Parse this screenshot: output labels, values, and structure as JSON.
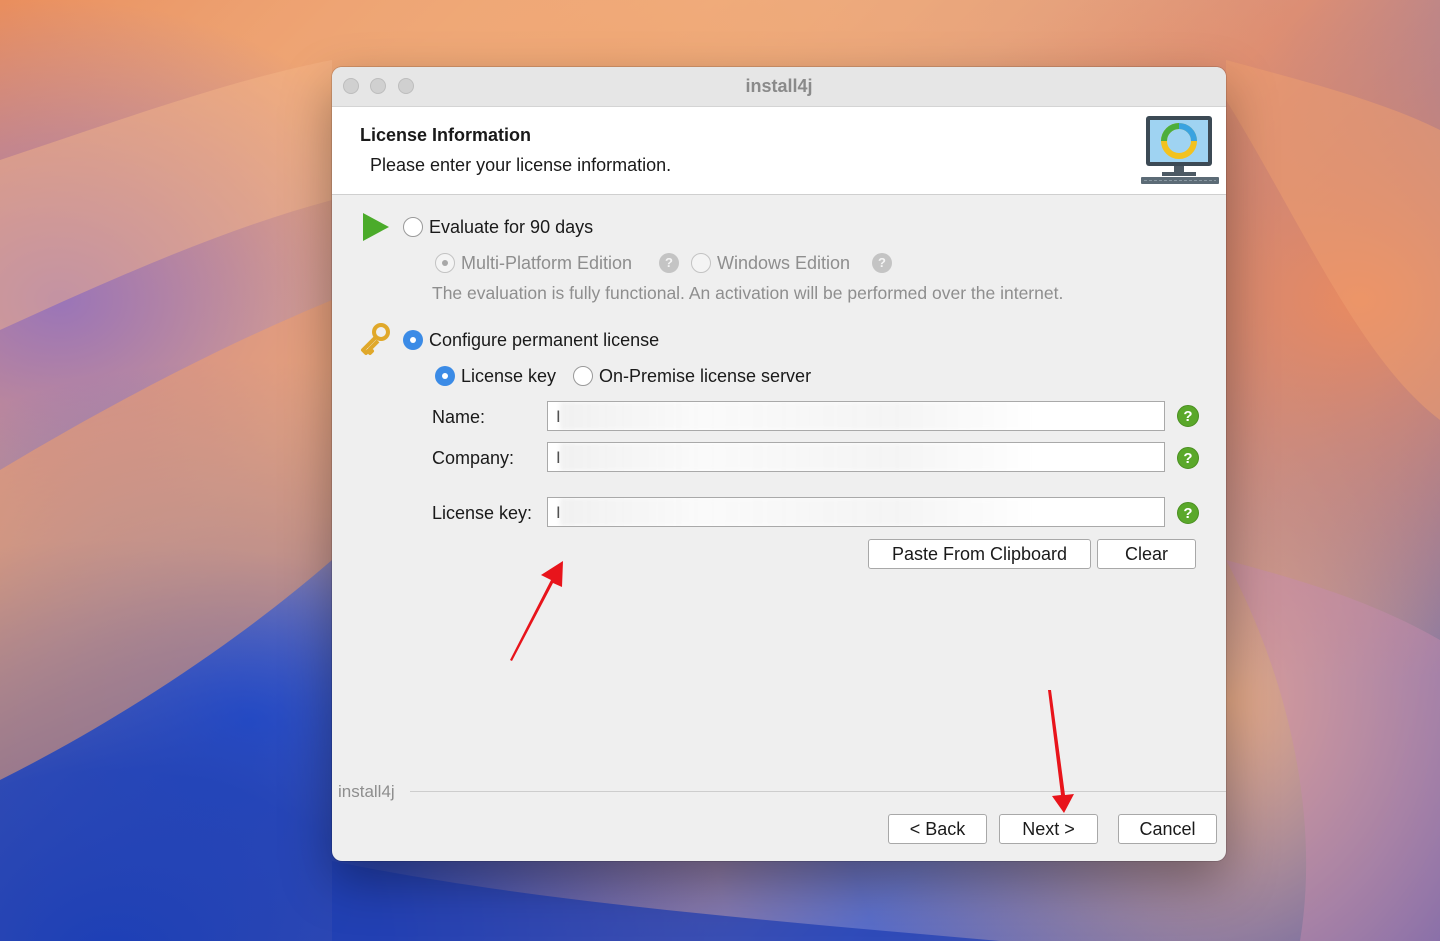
{
  "window": {
    "title": "install4j"
  },
  "header": {
    "title": "License Information",
    "subtitle": "Please enter your license information.",
    "logo_icon": "computer-monitor-icon"
  },
  "evaluate": {
    "label": "Evaluate for 90 days",
    "selected": false,
    "icon": "play-arrow-icon",
    "editions": {
      "multi_platform": "Multi-Platform Edition",
      "windows": "Windows Edition"
    },
    "note": "The evaluation is fully functional. An activation will be performed over the internet."
  },
  "permanent": {
    "label": "Configure permanent license",
    "selected": true,
    "icon": "key-icon",
    "types": {
      "license_key": "License key",
      "on_premise": "On-Premise license server"
    },
    "fields": {
      "name_label": "Name:",
      "name_value": "I",
      "company_label": "Company:",
      "company_value": "I",
      "key_label": "License key:",
      "key_value": "I"
    },
    "buttons": {
      "paste": "Paste From Clipboard",
      "clear": "Clear"
    }
  },
  "footer": {
    "brand": "install4j",
    "back": "< Back",
    "next": "Next >",
    "cancel": "Cancel"
  },
  "colors": {
    "accent": "#3b8be6",
    "help_green": "#5aa82a",
    "annotation_red": "#e8141b"
  }
}
